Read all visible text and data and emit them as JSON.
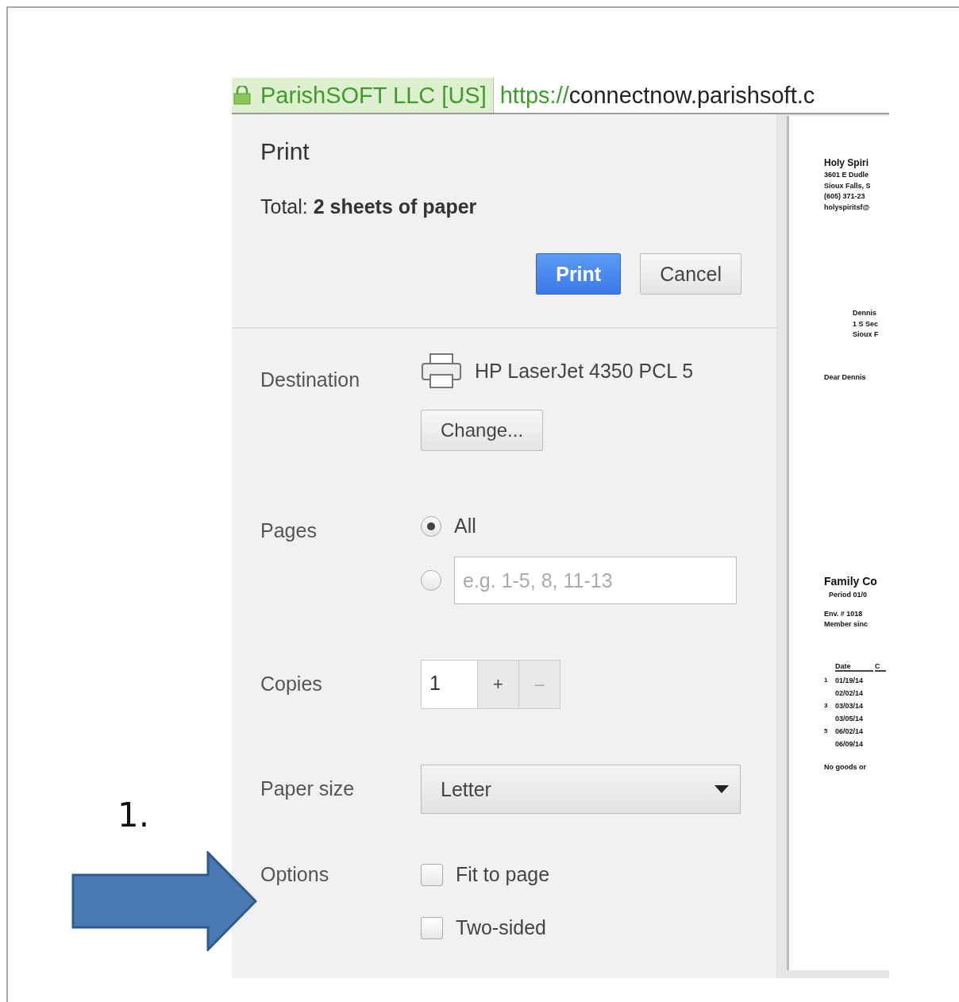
{
  "annotation": {
    "label": "1."
  },
  "address_bar": {
    "site_identity": "ParishSOFT LLC [US]",
    "url_scheme": "https://",
    "url_rest": "connectnow.parishsoft.c"
  },
  "print_panel": {
    "title": "Print",
    "total_label": "Total:",
    "total_value": "2 sheets of paper",
    "buttons": [
      {
        "label": "Print",
        "kind": "primary"
      },
      {
        "label": "Cancel",
        "kind": "secondary"
      }
    ]
  },
  "settings": [
    {
      "kind": "destination",
      "label": "Destination",
      "printer": "HP LaserJet 4350 PCL 5",
      "button": "Change..."
    },
    {
      "kind": "pages",
      "label": "Pages",
      "options": [
        {
          "kind": "all",
          "label": "All",
          "selected": true
        },
        {
          "kind": "range",
          "placeholder": "e.g. 1-5, 8, 11-13",
          "selected": false
        }
      ]
    },
    {
      "kind": "copies",
      "label": "Copies",
      "value": "1",
      "increment": "+",
      "decrement": "–"
    },
    {
      "kind": "select",
      "label": "Paper size",
      "value": "Letter"
    },
    {
      "kind": "checkboxes",
      "label": "Options",
      "options": [
        {
          "label": "Fit to page",
          "checked": false
        },
        {
          "label": "Two-sided",
          "checked": false
        }
      ]
    }
  ],
  "preview": {
    "sender": [
      "Holy Spiri",
      "3601 E Dudle",
      "Sioux Falls, S",
      "(605) 371-23",
      "holyspiritsf@"
    ],
    "recipient": [
      "Dennis",
      "1 S Sec",
      "Sioux F"
    ],
    "salutation": "Dear Dennis",
    "statement_title": "Family Co",
    "statement_period": "Period 01/0",
    "member_info": [
      "Env. # 1018",
      "Member sinc"
    ],
    "table_header": [
      "Date",
      "C"
    ],
    "table_rows": [
      [
        "1",
        "01/19/14"
      ],
      [
        "",
        "02/02/14"
      ],
      [
        "3",
        "03/03/14"
      ],
      [
        "",
        "03/05/14"
      ],
      [
        "5",
        "06/02/14"
      ],
      [
        "",
        "06/09/14"
      ]
    ],
    "footer": "No goods or"
  }
}
